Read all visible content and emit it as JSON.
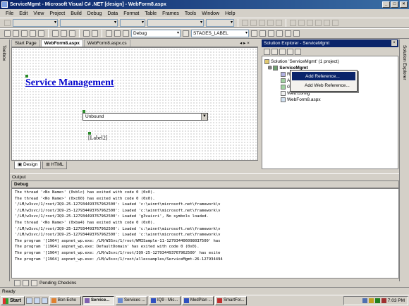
{
  "window": {
    "title": "ServiceMgmt - Microsoft Visual C# .NET [design] - WebForm8.aspx",
    "controls": [
      "_",
      "□",
      "×"
    ]
  },
  "menu": [
    "File",
    "Edit",
    "View",
    "Project",
    "Build",
    "Debug",
    "Data",
    "Format",
    "Table",
    "Frames",
    "Tools",
    "Window",
    "Help"
  ],
  "toolbar": {
    "config": "Debug",
    "target": "STAGES_LABEL"
  },
  "side": {
    "toolbox_label": "Toolbox",
    "explorer_label": "Solution Explorer"
  },
  "tabs": [
    "Start Page",
    "WebForm8.aspx",
    "WebForm8.aspx.cs"
  ],
  "doc_controls": "◂ ▸ ×",
  "designer": {
    "heading": "Service Management",
    "dropdown_value": "Unbound",
    "label_text": "[Label2]",
    "view_tabs": [
      "Design",
      "HTML"
    ]
  },
  "solution_explorer": {
    "title": "Solution Explorer - ServiceMgmt",
    "tree": {
      "solution": "Solution 'ServiceMgmt' (1 project)",
      "project": "ServiceMgmt",
      "items": [
        "R",
        "A",
        "G",
        "Web.config",
        "WebForm8.aspx"
      ]
    },
    "context_menu": [
      "Add Reference...",
      "Add Web Reference..."
    ]
  },
  "output": {
    "panel_title": "Output",
    "source": "Debug",
    "lines": [
      "The thread '<No Name>' (0xblc) has exited with code 0 (0x0).",
      "The thread '<No Name>' (0xc60) has exited with code 0 (0x0).",
      "'/LM/w3svc/1/root/IQ9-25-127934493767962500': Loaded 'c:\\winnt\\microsoft.net\\framework\\v",
      "'/LM/w3svc/1/root/IQ9-25-127934493767962500': Loaded 'c:\\winnt\\microsoft.net\\framework\\v",
      "'/LM/w3svc/1/root/IQ9-25-127934493767962500': Loaded 'g3vaicri', No symbols loaded.",
      "The thread '<No Name>' (0xba4) has exited with code 0 (0x0).",
      "'/LM/w3svc/1/root/IQ9-25-127934493767962500': Loaded 'c:\\winnt\\microsoft.net\\framework\\v",
      "'/LM/w3svc/1/root/IQ9-25-127934493767962500': Loaded 'c:\\winnt\\microsoft.net\\framework\\v",
      "The program '[1964] aspnet_wp.exe: /LM/W3Svc/1/root/WMISample-11-127934406098037500' has",
      "The program '[1964] aspnet_wp.exe: DefaultDomain' has exited with code 0 (0x0).",
      "The program '[1964] aspnet_wp.exe: /LM/w3svc/1/root/IQ9-25-127934493767962500' has exite",
      "The program '[1964] aspnet_wp.exe: /LM/w3svc/1/root/allexsamples/ServiceMgmt-26-127934494"
    ],
    "bottom_tab": "Pending Checkins"
  },
  "status": "Ready",
  "taskbar": {
    "start": "Start",
    "buttons": [
      "Bon Echo",
      "Service...",
      "Services ...",
      "IQ9 - Mic...",
      "MedPlan ...",
      "SmartFol..."
    ],
    "active_index": 1,
    "clock": "7:03 PM"
  }
}
